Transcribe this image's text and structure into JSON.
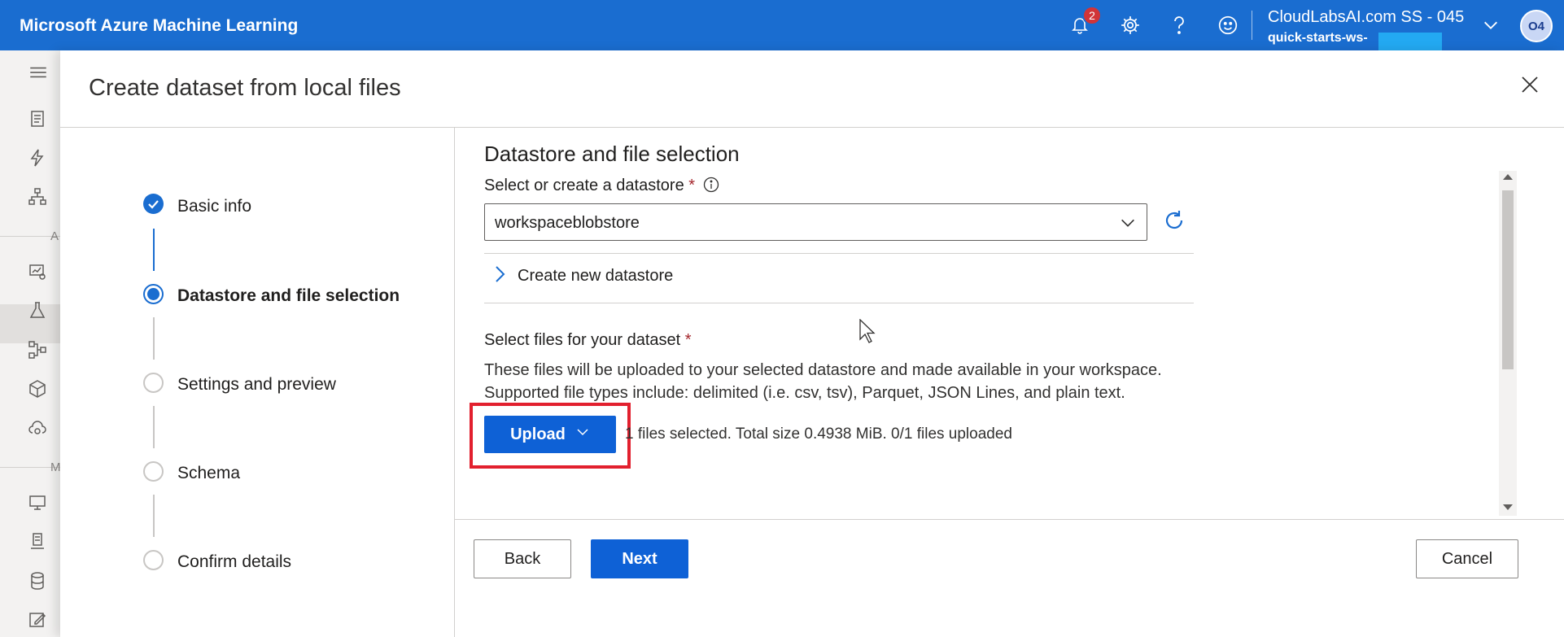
{
  "header": {
    "app_title": "Microsoft Azure Machine Learning",
    "notifications_count": "2",
    "account_name": "CloudLabsAI.com SS - 045",
    "workspace_name": "quick-starts-ws-",
    "avatar_initials": "O4",
    "icons": [
      "bell-icon",
      "gear-icon",
      "help-icon",
      "smiley-icon",
      "chevron-down-icon"
    ]
  },
  "rail": {
    "section_letters": [
      "A",
      "M"
    ],
    "icons": [
      "hamburger-icon",
      "notebook-icon",
      "automl-icon",
      "designer-icon",
      "datasets-icon",
      "experiments-icon",
      "pipelines-icon",
      "models-icon",
      "endpoints-icon",
      "compute-icon",
      "environments-icon",
      "datastores-icon",
      "labeling-icon"
    ]
  },
  "panel": {
    "title": "Create dataset from local files",
    "steps": [
      {
        "label": "Basic info",
        "state": "done"
      },
      {
        "label": "Datastore and file selection",
        "state": "current"
      },
      {
        "label": "Settings and preview",
        "state": "pending"
      },
      {
        "label": "Schema",
        "state": "pending"
      },
      {
        "label": "Confirm details",
        "state": "pending"
      }
    ]
  },
  "content": {
    "section_title": "Datastore and file selection",
    "datastore_label": "Select or create a datastore",
    "required_mark": "*",
    "datastore_value": "workspaceblobstore",
    "create_new_label": "Create new datastore",
    "files_label": "Select files for your dataset",
    "desc_line1": "These files will be uploaded to your selected datastore and made available in your workspace.",
    "desc_line2": "Supported file types include: delimited (i.e. csv, tsv), Parquet, JSON Lines, and plain text.",
    "upload_label": "Upload",
    "upload_status": "1 files selected. Total size 0.4938 MiB. 0/1 files uploaded"
  },
  "footer": {
    "back_label": "Back",
    "next_label": "Next",
    "cancel_label": "Cancel"
  },
  "colors": {
    "brand": "#1a6dd0",
    "primary_button": "#0e61d6",
    "highlight": "#e2202e",
    "badge": "#d13438"
  }
}
